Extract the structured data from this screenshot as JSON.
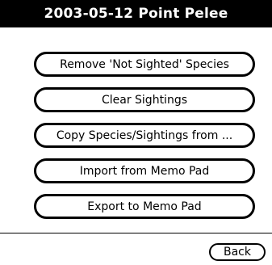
{
  "title_bar": {
    "title": "2003-05-12 Point Pelee"
  },
  "menu": {
    "remove_not_sighted": "Remove 'Not Sighted' Species",
    "clear_sightings": "Clear Sightings",
    "copy_species": "Copy Species/Sightings from ...",
    "import_memo": "Import from Memo Pad",
    "export_memo": "Export to Memo Pad"
  },
  "footer": {
    "back_label": "Back"
  },
  "colors": {
    "background": "#ffffff",
    "foreground": "#000000",
    "title_bar_bg": "#000000",
    "title_bar_fg": "#ffffff"
  }
}
